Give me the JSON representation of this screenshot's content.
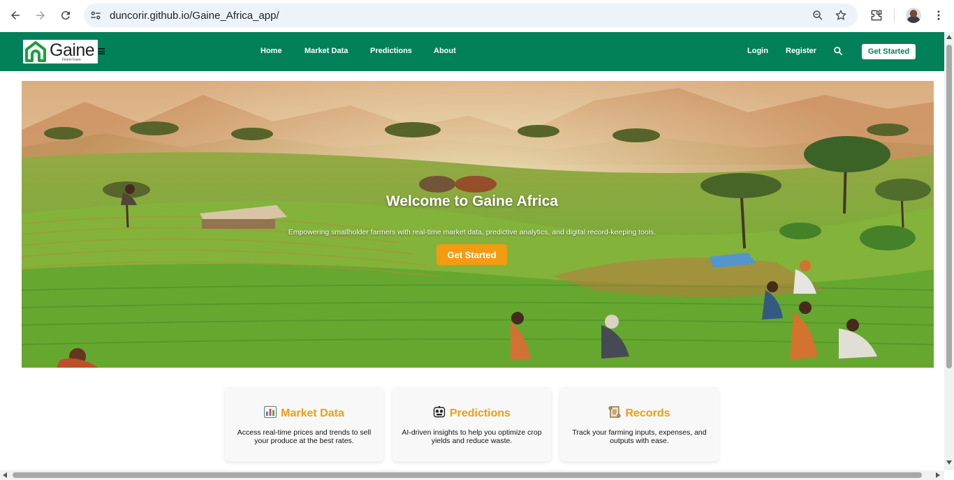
{
  "browser": {
    "url": "duncorir.github.io/Gaine_Africa_app/"
  },
  "site": {
    "logo_text": "Gaine",
    "logo_tagline": "Fimmi Farm",
    "nav": {
      "home": "Home",
      "market_data": "Market Data",
      "predictions": "Predictions",
      "about": "About"
    },
    "auth": {
      "login": "Login",
      "register": "Register"
    },
    "cta_label": "Get Started"
  },
  "hero": {
    "title": "Welcome to Gaine Africa",
    "subtitle": "Empowering smallholder farmers with real-time market data, predictive analytics, and digital record-keeping tools.",
    "cta_label": "Get Started"
  },
  "features": [
    {
      "icon": "bar-chart-icon",
      "title": "Market Data",
      "text": "Access real-time prices and trends to sell your produce at the best rates."
    },
    {
      "icon": "robot-face-icon",
      "title": "Predictions",
      "text": "AI-driven insights to help you optimize crop yields and reduce waste."
    },
    {
      "icon": "scroll-icon",
      "title": "Records",
      "text": "Track your farming inputs, expenses, and outputs with ease."
    }
  ],
  "colors": {
    "brand_green": "#01805a",
    "accent_orange": "#f39c12"
  }
}
